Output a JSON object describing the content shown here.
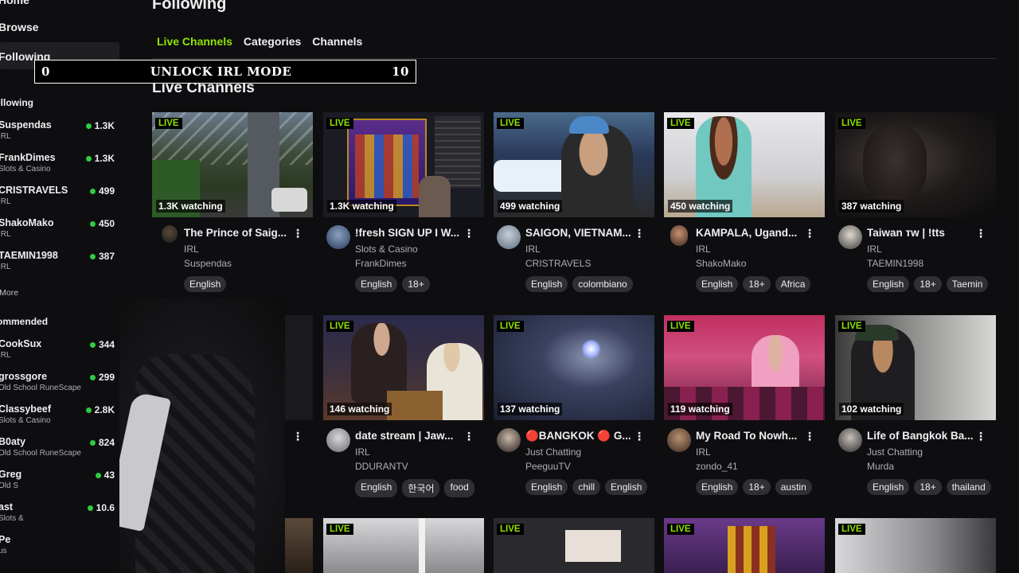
{
  "sidebar": {
    "nav": {
      "home": "Home",
      "browse": "Browse",
      "following": "Following"
    },
    "sections": {
      "following": "Following",
      "recommended": "Recommended"
    },
    "following_channels": [
      {
        "name": "Suspendas",
        "category": "IRL",
        "viewers": "1.3K"
      },
      {
        "name": "FrankDimes",
        "category": "Slots & Casino",
        "viewers": "1.3K"
      },
      {
        "name": "CRISTRAVELS",
        "category": "IRL",
        "viewers": "499"
      },
      {
        "name": "ShakoMako",
        "category": "IRL",
        "viewers": "450"
      },
      {
        "name": "TAEMIN1998",
        "category": "IRL",
        "viewers": "387"
      }
    ],
    "show_more": "Show More",
    "recommended_channels": [
      {
        "name": "CookSux",
        "category": "IRL",
        "viewers": "344"
      },
      {
        "name": "grossgore",
        "category": "Old School RuneScape",
        "viewers": "299"
      },
      {
        "name": "Classybeef",
        "category": "Slots & Casino",
        "viewers": "2.8K"
      },
      {
        "name": "B0aty",
        "category": "Old School RuneScape",
        "viewers": "824"
      },
      {
        "name": "Greg",
        "category": "Old S",
        "viewers": "43"
      },
      {
        "name": "ast",
        "category": "Slots &",
        "viewers": "10.6"
      },
      {
        "name": "Pe",
        "category": "us",
        "viewers": ""
      }
    ]
  },
  "header": {
    "title": "Following"
  },
  "tabs": [
    {
      "label": "Live Channels",
      "active": true
    },
    {
      "label": "Categories",
      "active": false
    },
    {
      "label": "Channels",
      "active": false
    }
  ],
  "section_title": "Live Channels",
  "overlay": {
    "left": "0",
    "label": "UNLOCK IRL MODE",
    "right": "10"
  },
  "live_badge": "LIVE",
  "colors": {
    "accent": "#8fe300",
    "live_dot": "#2ecc40",
    "background": "#0e0e10"
  },
  "cards": [
    {
      "viewers": "1.3K watching",
      "title": "The Prince of Saig...",
      "category": "IRL",
      "channel": "Suspendas",
      "tags": [
        "English"
      ]
    },
    {
      "viewers": "1.3K watching",
      "title": "!fresh SIGN UP I W...",
      "category": "Slots & Casino",
      "channel": "FrankDimes",
      "tags": [
        "English",
        "18+"
      ]
    },
    {
      "viewers": "499 watching",
      "title": "SAIGON, VIETNAM...",
      "category": "IRL",
      "channel": "CRISTRAVELS",
      "tags": [
        "English",
        "colombiano"
      ]
    },
    {
      "viewers": "450 watching",
      "title": "KAMPALA, Ugand...",
      "category": "IRL",
      "channel": "ShakoMako",
      "tags": [
        "English",
        "18+",
        "Africa"
      ]
    },
    {
      "viewers": "387 watching",
      "title": "Taiwan ᴛᴡ | !tts",
      "category": "IRL",
      "channel": "TAEMIN1998",
      "tags": [
        "English",
        "18+",
        "Taemin"
      ]
    },
    {
      "viewers": "146 watching",
      "title": "date stream | Jaw...",
      "category": "IRL",
      "channel": "DDURANTV",
      "tags": [
        "English",
        "한국어",
        "food"
      ]
    },
    {
      "viewers": "137 watching",
      "title": "🔴BANGKOK 🔴 G...",
      "category": "Just Chatting",
      "channel": "PeeguuTV",
      "tags": [
        "English",
        "chill",
        "English"
      ]
    },
    {
      "viewers": "119 watching",
      "title": "My Road To Nowh...",
      "category": "IRL",
      "channel": "zondo_41",
      "tags": [
        "English",
        "18+",
        "austin"
      ]
    },
    {
      "viewers": "102 watching",
      "title": "Life of Bangkok Ba...",
      "category": "Just Chatting",
      "channel": "Murda",
      "tags": [
        "English",
        "18+",
        "thailand"
      ]
    }
  ]
}
